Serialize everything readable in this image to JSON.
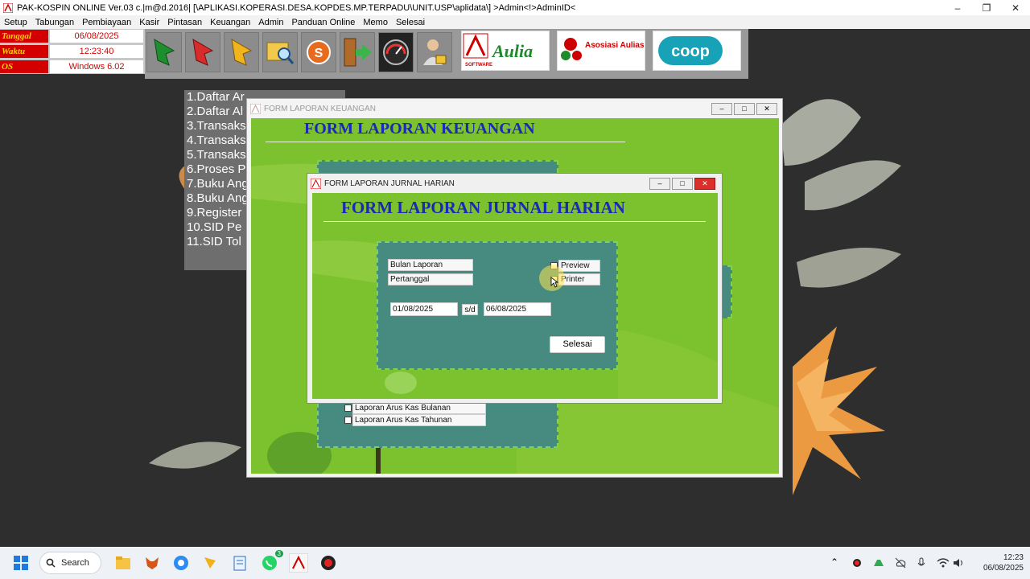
{
  "app": {
    "title": "PAK-KOSPIN ONLINE Ver.03 c.|m@d.2016| [\\APLIKASI.KOPERASI.DESA.KOPDES.MP.TERPADU\\UNIT.USP\\aplidata\\] >Admin<!>AdminID<"
  },
  "menu": [
    "Setup",
    "Tabungan",
    "Pembiayaan",
    "Kasir",
    "Pintasan",
    "Keuangan",
    "Admin",
    "Panduan Online",
    "Memo",
    "Selesai"
  ],
  "info": {
    "tanggal_label": "Tanggal",
    "tanggal_value": "06/08/2025",
    "waktu_label": "Waktu",
    "waktu_value": "12:23:40",
    "os_label": "OS",
    "os_value": "Windows 6.02"
  },
  "toolbar_icons": [
    "green-arrow-icon",
    "red-arrow-icon",
    "yellow-arrow-icon",
    "folder-search-icon",
    "s-coin-icon",
    "exit-door-icon",
    "gauge-icon",
    "user-lock-icon"
  ],
  "logos": {
    "aulia": "Aulia",
    "software": "SOFTWARE",
    "asosiasi": "Asosiasi Auliasoft Indonesia",
    "coop": "coop"
  },
  "sidelist": [
    "1.Daftar Ar",
    "2.Daftar Al",
    "3.Transaks",
    "4.Transaks",
    "5.Transaks",
    "6.Proses P",
    "7.Buku Ang",
    "8.Buku Ang",
    "9.Register",
    "10.SID Pe",
    "11.SID Tol"
  ],
  "keuangan": {
    "window_title": "FORM LAPORAN KEUANGAN",
    "heading": "FORM LAPORAN KEUANGAN",
    "items": [
      "Laporan Arus Kas Bulanan",
      "Laporan Arus Kas Tahunan"
    ]
  },
  "jurnal": {
    "window_title": "FORM LAPORAN JURNAL HARIAN",
    "heading": "FORM LAPORAN JURNAL HARIAN",
    "bulan_label": "Bulan Laporan",
    "pertanggal_label": "Pertanggal",
    "preview_label": "Preview",
    "printer_label": "Printer",
    "date_from": "01/08/2025",
    "sd_label": "s/d",
    "date_to": "06/08/2025",
    "selesai_label": "Selesai"
  },
  "taskbar": {
    "search_label": "Search",
    "badge": "3",
    "time": "12:23",
    "date": "06/08/2025"
  }
}
